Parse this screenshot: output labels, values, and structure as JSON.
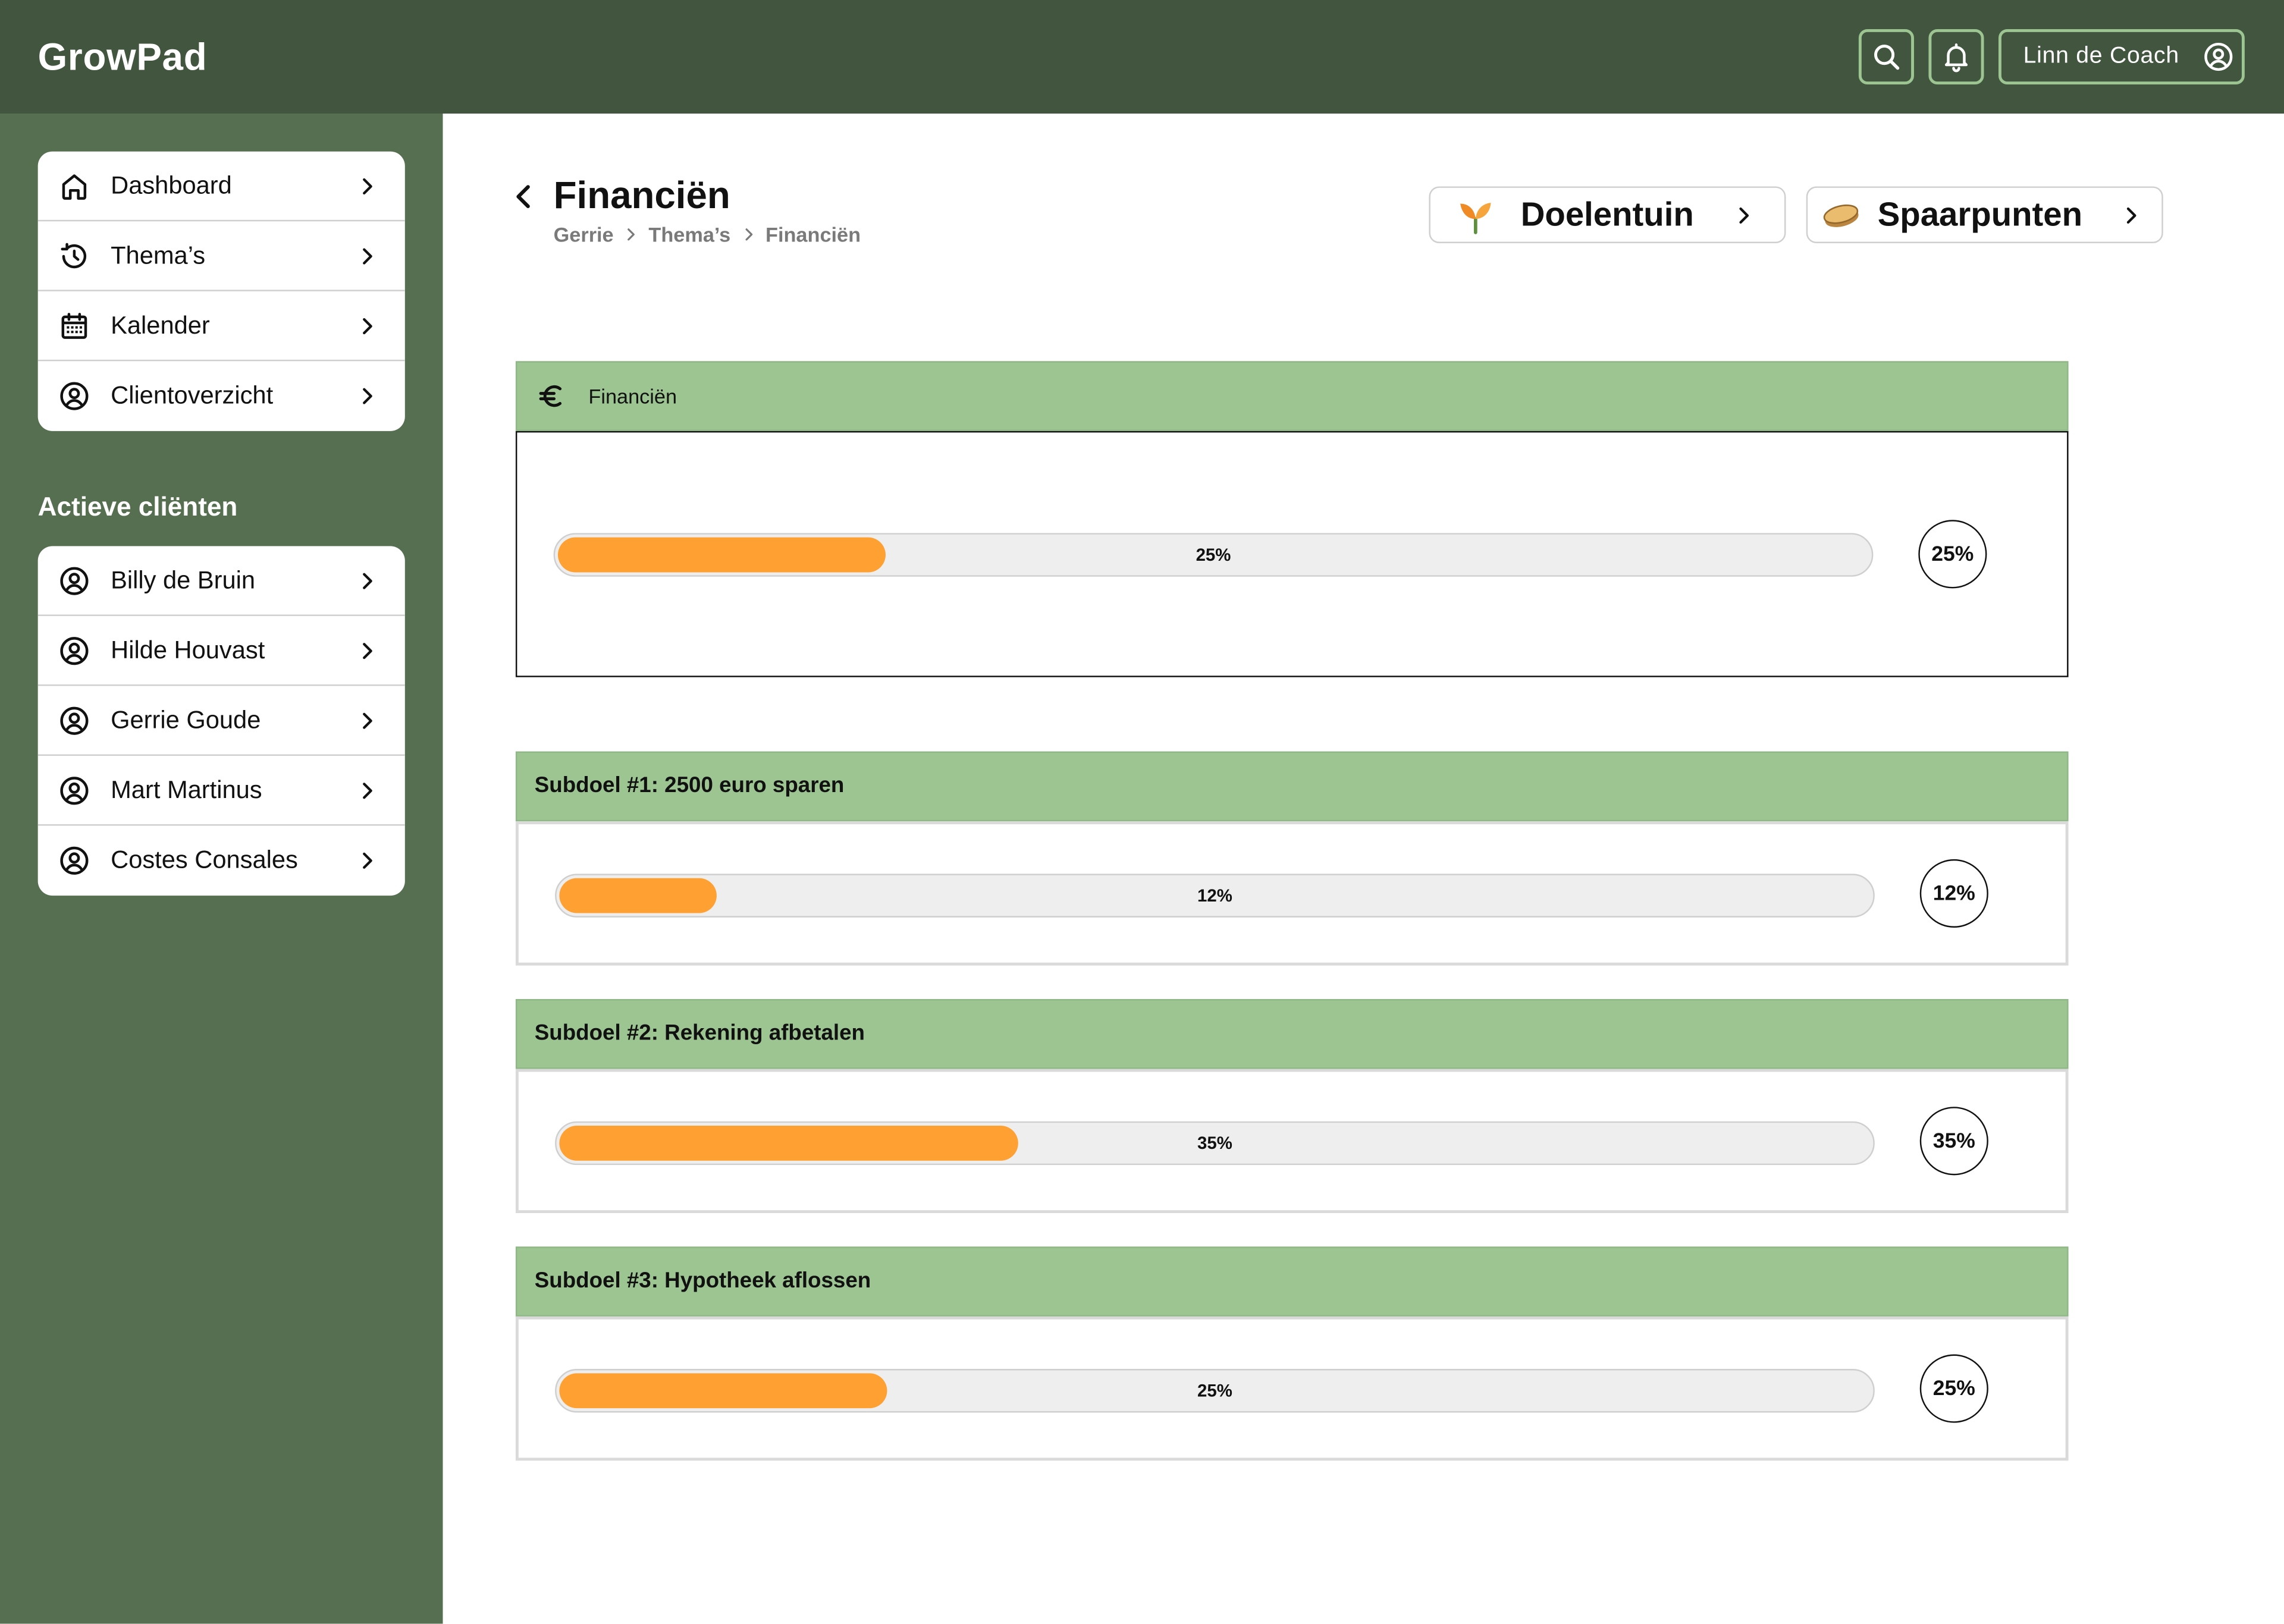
{
  "app": {
    "name": "GrowPad"
  },
  "header": {
    "user_name": "Linn de Coach",
    "search_icon": "search-icon",
    "notifications_icon": "bell-icon",
    "user_icon": "user-circle-icon"
  },
  "sidebar": {
    "nav": [
      {
        "label": "Dashboard",
        "icon": "home-icon"
      },
      {
        "label": "Thema’s",
        "icon": "history-icon"
      },
      {
        "label": "Kalender",
        "icon": "calendar-icon"
      },
      {
        "label": "Clientoverzicht",
        "icon": "user-circle-icon"
      }
    ],
    "clients_heading": "Actieve cliënten",
    "clients": [
      {
        "label": "Billy de Bruin",
        "icon": "user-circle-icon"
      },
      {
        "label": "Hilde Houvast",
        "icon": "user-circle-icon"
      },
      {
        "label": "Gerrie Goude",
        "icon": "user-circle-icon"
      },
      {
        "label": "Mart Martinus",
        "icon": "user-circle-icon"
      },
      {
        "label": "Costes Consales",
        "icon": "user-circle-icon"
      }
    ]
  },
  "page": {
    "title": "Financiën",
    "breadcrumb": [
      "Gerrie",
      "Thema’s",
      "Financiën"
    ],
    "actions": [
      {
        "label": "Doelentuin",
        "icon": "sprout-icon"
      },
      {
        "label": "Spaarpunten",
        "icon": "coin-icon"
      }
    ]
  },
  "theme": {
    "title": "Financiën",
    "icon": "euro-icon",
    "progress": 25,
    "progress_label": "25%"
  },
  "subgoals": [
    {
      "title": "Subdoel #1: 2500 euro sparen",
      "progress": 12,
      "progress_label": "12%"
    },
    {
      "title": "Subdoel #2: Rekening afbetalen",
      "progress": 35,
      "progress_label": "35%"
    },
    {
      "title": "Subdoel #3: Hypotheek aflossen",
      "progress": 25,
      "progress_label": "25%"
    }
  ],
  "colors": {
    "header": "#41553F",
    "sidebar": "#566F50",
    "panel_header": "#9CC592",
    "progress_fill": "#FFA033",
    "progress_track": "#EEEEEE",
    "accent_border": "#9CC592"
  }
}
